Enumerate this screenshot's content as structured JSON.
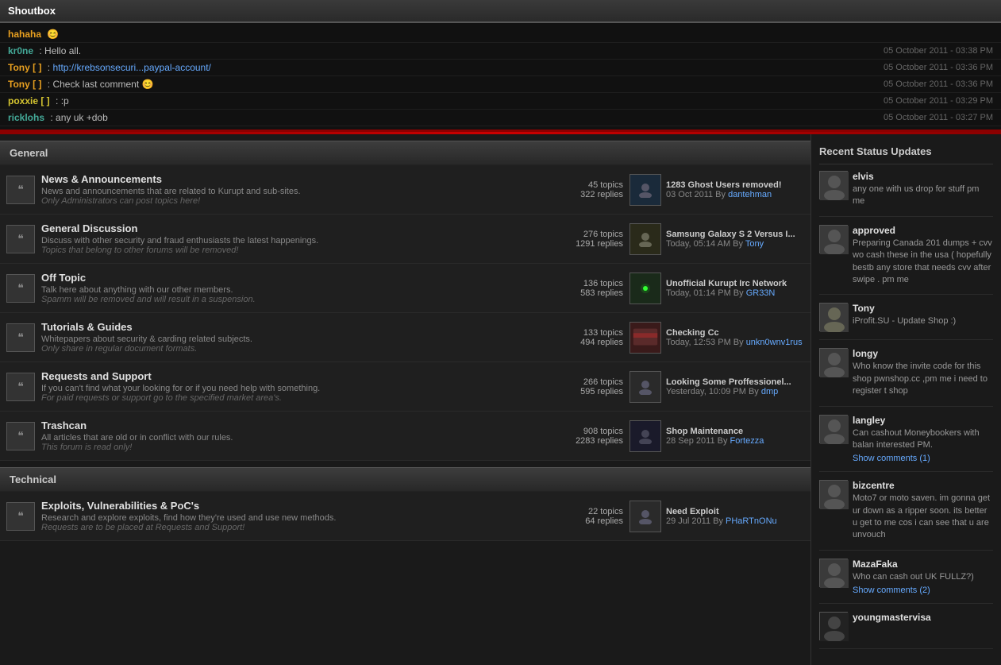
{
  "shoutbox": {
    "title": "Shoutbox",
    "messages": [
      {
        "user": "hahaha",
        "userClass": "orange",
        "msg": "😊",
        "time": ""
      },
      {
        "user": "kr0ne",
        "userClass": "green",
        "msg": "Hello all.",
        "time": "05 October 2011 - 03:38 PM",
        "separator": " : "
      },
      {
        "user": "Tony [ ]",
        "userClass": "orange",
        "msg": "http://krebsonsecuri...paypal-account/",
        "isLink": true,
        "time": "05 October 2011 - 03:36 PM",
        "separator": " : "
      },
      {
        "user": "Tony [ ]",
        "userClass": "orange",
        "msg": "Check last comment 😊",
        "time": "05 October 2011 - 03:36 PM",
        "separator": " : "
      },
      {
        "user": "poxxie [ ]",
        "userClass": "yellow",
        "msg": ":p",
        "time": "05 October 2011 - 03:29 PM",
        "separator": " : "
      },
      {
        "user": "ricklohs",
        "userClass": "green",
        "msg": "any uk +dob",
        "time": "05 October 2011 - 03:27 PM",
        "separator": " : "
      }
    ]
  },
  "sections": [
    {
      "title": "General",
      "forums": [
        {
          "title": "News & Announcements",
          "desc": "News and announcements that are related to Kurupt and sub-sites.",
          "subdesc": "Only Administrators can post topics here!",
          "topics": "45 topics",
          "replies": "322 replies",
          "lastTitle": "1283 Ghost Users removed!",
          "lastDate": "03 Oct 2011",
          "lastBy": "dantehman",
          "thumbClass": "thumb-ghost"
        },
        {
          "title": "General Discussion",
          "desc": "Discuss with other security and fraud enthusiasts the latest happenings.",
          "subdesc": "Topics that belong to other forums will be removed!",
          "topics": "276 topics",
          "replies": "1291 replies",
          "lastTitle": "Samsung Galaxy S 2 Versus I...",
          "lastDate": "Today, 05:14 AM",
          "lastBy": "Tony",
          "thumbClass": "thumb-samsung"
        },
        {
          "title": "Off Topic",
          "desc": "Talk here about anything with our other members.",
          "subdesc": "Spamm will be removed and will result in a suspension.",
          "topics": "136 topics",
          "replies": "583 replies",
          "lastTitle": "Unofficial Kurupt Irc Network",
          "lastDate": "Today, 01:14 PM",
          "lastBy": "GR33N",
          "thumbClass": "thumb-irc"
        },
        {
          "title": "Tutorials & Guides",
          "desc": "Whitepapers about security & carding related subjects.",
          "subdesc": "Only share in regular document formats.",
          "topics": "133 topics",
          "replies": "494 replies",
          "lastTitle": "Checking Cc",
          "lastDate": "Today, 12:53 PM",
          "lastBy": "unkn0wnv1rus",
          "thumbClass": "thumb-cc"
        },
        {
          "title": "Requests and Support",
          "desc": "If you can't find what your looking for or if you need help with something.",
          "subdesc": "For paid requests or support go to the specified market area's.",
          "topics": "266 topics",
          "replies": "595 replies",
          "lastTitle": "Looking Some Proffessionel...",
          "lastDate": "Yesterday, 10:09 PM",
          "lastBy": "dmp",
          "thumbClass": "thumb-looking"
        },
        {
          "title": "Trashcan",
          "desc": "All articles that are old or in conflict with our rules.",
          "subdesc": "This forum is read only!",
          "topics": "908 topics",
          "replies": "2283 replies",
          "lastTitle": "Shop Maintenance",
          "lastDate": "28 Sep 2011",
          "lastBy": "Fortezza",
          "thumbClass": "thumb-shop"
        }
      ]
    },
    {
      "title": "Technical",
      "forums": [
        {
          "title": "Exploits, Vulnerabilities & PoC's",
          "desc": "Research and explore exploits, find how they're used and use new methods.",
          "subdesc": "Requests are to be placed at Requests and Support!",
          "topics": "22 topics",
          "replies": "64 replies",
          "lastTitle": "Need Exploit",
          "lastDate": "29 Jul 2011",
          "lastBy": "PHaRTnONu",
          "thumbClass": "thumb-exploit"
        }
      ]
    }
  ],
  "sidebar": {
    "title": "Recent Status Updates",
    "items": [
      {
        "user": "elvis",
        "msg": "any one with us drop for stuff pm me",
        "comments": null
      },
      {
        "user": "approved",
        "msg": "Preparing Canada 201 dumps + cvv wo cash these in the usa ( hopefully bestb any store that needs cvv after swipe . pm me",
        "comments": null
      },
      {
        "user": "Tony",
        "msg": "iProfit.SU - Update Shop :)",
        "comments": null
      },
      {
        "user": "longy",
        "msg": "Who know the invite code for this shop pwnshop.cc ,pm me i need to register t shop",
        "comments": null
      },
      {
        "user": "langley",
        "msg": "Can cashout Moneybookers with balan interested PM.",
        "comments": "Show comments (1)"
      },
      {
        "user": "bizcentre",
        "msg": "Moto7 or moto saven. im gonna get ur down as a ripper soon. its better u get to me cos i can see that u are unvouch",
        "comments": null
      },
      {
        "user": "MazaFaka",
        "msg": "Who can cash out UK FULLZ?)",
        "comments": "Show comments (2)"
      },
      {
        "user": "youngmastervisa",
        "msg": "",
        "comments": null
      }
    ]
  }
}
